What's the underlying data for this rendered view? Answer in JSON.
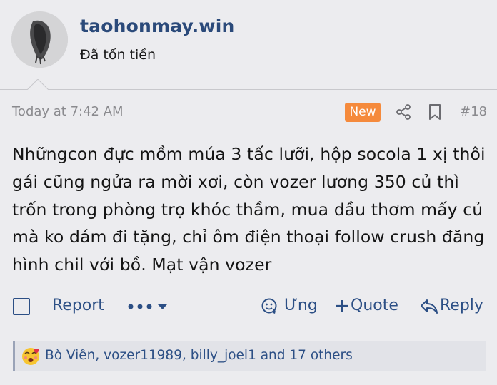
{
  "user": {
    "username": "taohonmay.win",
    "title": "Đã tốn tiền"
  },
  "post": {
    "time": "Today at 7:42 AM",
    "badge": "New",
    "number": "#18",
    "body": "Nhữngcon đực mồm múa 3 tấc lưỡi, hộp socola 1 xị thôi gái cũng ngửa ra mời xơi, còn vozer lương 350 củ thì trốn trong phòng trọ khóc thầm, mua dầu thơm mấy củ mà ko dám đi tặng, chỉ ôm điện thoại follow crush đăng hình chil với bồ. Mạt vận vozer"
  },
  "actions": {
    "report": "Report",
    "ung": "Ưng",
    "quote": "Quote",
    "reply": "Reply"
  },
  "reactions": {
    "text": "Bò Viên, vozer11989, billy_joel1 and 17 others"
  },
  "colors": {
    "accent": "#2c4f85",
    "username": "#2b4a7a",
    "badge": "#f58a3c",
    "muted": "#8a8a8e",
    "background": "#ececef"
  },
  "icons": [
    "share-icon",
    "bookmark-icon",
    "more-icon",
    "chevron-down-icon",
    "ung-icon",
    "plus-icon",
    "reply-icon",
    "reaction-emoji-icon"
  ]
}
